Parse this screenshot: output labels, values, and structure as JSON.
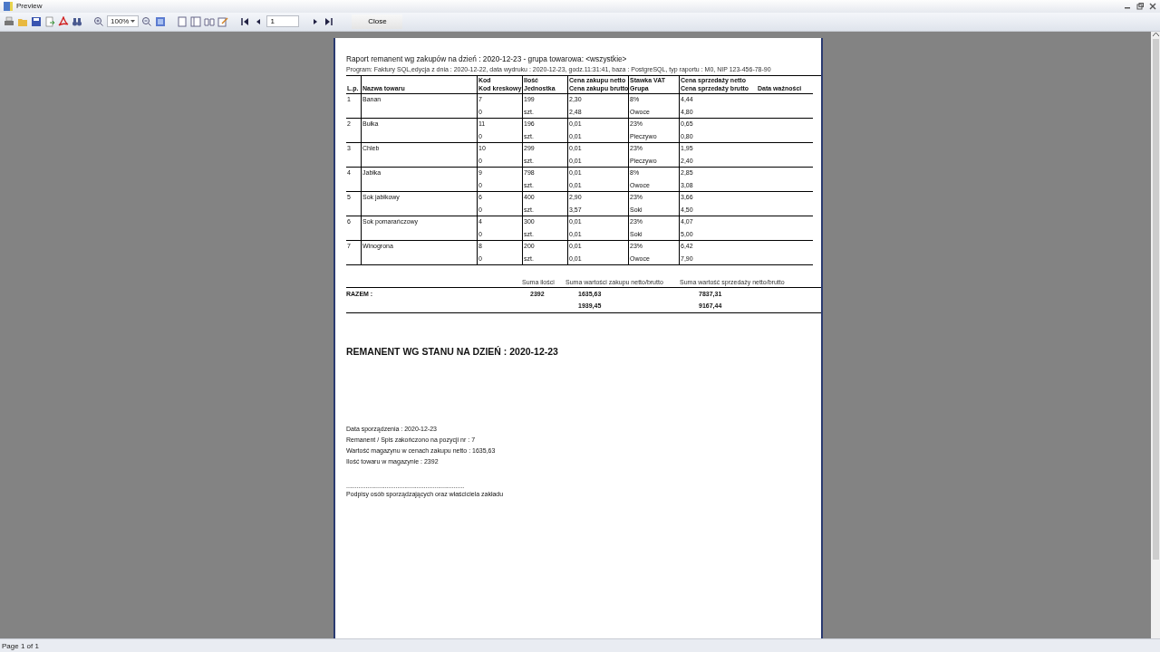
{
  "window": {
    "title": "Preview"
  },
  "toolbar": {
    "zoom": "100%",
    "page_number": "1",
    "close": "Close"
  },
  "report": {
    "title": "Raport remanent wg zakupów na dzień : 2020-12-23  -  grupa towarowa: <wszystkie>",
    "meta": "Program: Faktury SQL,edycja z dnia : 2020-12-22, data wydruku : 2020-12-23, godz.11:31:41, baza : PostgreSQL, typ raportu : M0, NIP 123-456-78-90",
    "columns": [
      {
        "bottom": "L.p."
      },
      {
        "bottom": "Nazwa towaru"
      },
      {
        "top": "Kod",
        "bottom": "Kod kreskowy"
      },
      {
        "top": "Ilość",
        "bottom": "Jednostka"
      },
      {
        "top": "Cena zakupu netto",
        "bottom": "Cena zakupu brutto"
      },
      {
        "top": "Stawka VAT",
        "bottom": "Grupa"
      },
      {
        "top": "Cena sprzedaży netto",
        "bottom": "Cena sprzedaży brutto"
      },
      {
        "bottom": "Data ważności"
      }
    ],
    "rows": [
      {
        "lp": "1",
        "name": "Banan",
        "code": "7",
        "barcode": "0",
        "qty": "199",
        "unit": "szt.",
        "buy_net": "2,30",
        "buy_gross": "2,48",
        "vat": "8%",
        "group": "Owoce",
        "sell_net": "4,44",
        "sell_gross": "4,80"
      },
      {
        "lp": "2",
        "name": "Bułka",
        "code": "11",
        "barcode": "0",
        "qty": "196",
        "unit": "szt.",
        "buy_net": "0,01",
        "buy_gross": "0,01",
        "vat": "23%",
        "group": "Pieczywo",
        "sell_net": "0,65",
        "sell_gross": "0,80"
      },
      {
        "lp": "3",
        "name": "Chleb",
        "code": "10",
        "barcode": "0",
        "qty": "299",
        "unit": "szt.",
        "buy_net": "0,01",
        "buy_gross": "0,01",
        "vat": "23%",
        "group": "Pieczywo",
        "sell_net": "1,95",
        "sell_gross": "2,40"
      },
      {
        "lp": "4",
        "name": "Jabłka",
        "code": "9",
        "barcode": "0",
        "qty": "798",
        "unit": "szt.",
        "buy_net": "0,01",
        "buy_gross": "0,01",
        "vat": "8%",
        "group": "Owoce",
        "sell_net": "2,85",
        "sell_gross": "3,08"
      },
      {
        "lp": "5",
        "name": "Sok jabłkowy",
        "code": "6",
        "barcode": "0",
        "qty": "400",
        "unit": "szt.",
        "buy_net": "2,90",
        "buy_gross": "3,57",
        "vat": "23%",
        "group": "Soki",
        "sell_net": "3,66",
        "sell_gross": "4,50"
      },
      {
        "lp": "6",
        "name": "Sok pomarańczowy",
        "code": "4",
        "barcode": "0",
        "qty": "300",
        "unit": "szt.",
        "buy_net": "0,01",
        "buy_gross": "0,01",
        "vat": "23%",
        "group": "Soki",
        "sell_net": "4,07",
        "sell_gross": "5,00"
      },
      {
        "lp": "7",
        "name": "Winogrona",
        "code": "8",
        "barcode": "0",
        "qty": "200",
        "unit": "szt.",
        "buy_net": "0,01",
        "buy_gross": "0,01",
        "vat": "23%",
        "group": "Owoce",
        "sell_net": "6,42",
        "sell_gross": "7,90"
      }
    ],
    "totals": {
      "qty_label": "Suma ilości",
      "buy_label": "Suma wartości zakupu netto/brutto",
      "sell_label": "Suma wartość sprzedaży netto/brutto",
      "label": "RAZEM :",
      "qty": "2392",
      "buy_net": "1635,63",
      "buy_gross": "1939,45",
      "sell_net": "7837,31",
      "sell_gross": "9167,44"
    },
    "heading": "REMANENT WG STANU NA DZIEŃ :  2020-12-23",
    "summary": [
      "Data sporządzenia : 2020-12-23",
      "Remanent / Spis zakończono na pozycji nr : 7",
      "Wartość magazynu w cenach zakupu netto : 1635,63",
      "Ilość towaru w magazynie : 2392"
    ],
    "signature_line": "...................................................................",
    "signature": "Podpisy osób sporządzających oraz właściciela zakładu"
  },
  "status_bar": "Page 1 of 1"
}
